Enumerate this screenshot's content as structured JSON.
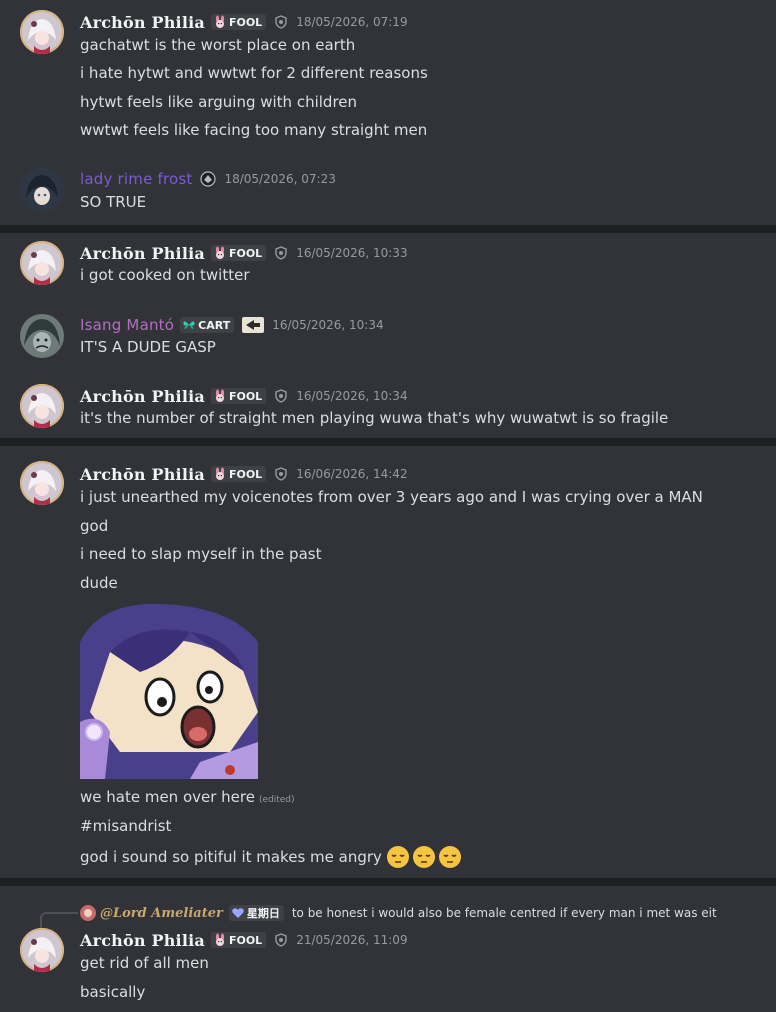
{
  "messages": {
    "m1": {
      "author": "Archōn Philia",
      "tag": "FOOL",
      "timestamp": "18/05/2026, 07:19",
      "lines": [
        "gachatwt is the worst place on earth",
        "i hate hytwt and wwtwt for 2 different reasons",
        "hytwt feels like arguing with children",
        "wwtwt feels like facing too many straight men"
      ]
    },
    "m2": {
      "author": "lady rime frost",
      "timestamp": "18/05/2026, 07:23",
      "lines": [
        "SO TRUE"
      ]
    },
    "m3": {
      "author": "Archōn Philia",
      "tag": "FOOL",
      "timestamp": "16/05/2026, 10:33",
      "lines": [
        "i got cooked on twitter"
      ]
    },
    "m4": {
      "author": "Isang Mantó",
      "tag": "CART",
      "timestamp": "16/05/2026, 10:34",
      "lines": [
        "IT'S A DUDE GASP"
      ]
    },
    "m5": {
      "author": "Archōn Philia",
      "tag": "FOOL",
      "timestamp": "16/05/2026, 10:34",
      "lines": [
        "it's the number of straight men playing wuwa that's why wuwatwt is so fragile"
      ]
    },
    "m6": {
      "author": "Archōn Philia",
      "tag": "FOOL",
      "timestamp": "16/06/2026, 14:42",
      "lines": [
        "i just unearthed my voicenotes from over 3 years ago and I was crying over a MAN",
        "god",
        "i need to slap myself in the past",
        "dude"
      ],
      "after_sticker": [
        "we hate men over here",
        "#misandrist",
        "god i sound so pitiful it makes me angry"
      ],
      "edited_label": "(edited)",
      "emoji_count": 3
    },
    "m7": {
      "reply_author": "@Lord Ameliater",
      "reply_tag": "星期日",
      "reply_text": "to be honest i would also be female centred if every man i met was eit",
      "author": "Archōn Philia",
      "tag": "FOOL",
      "timestamp": "21/05/2026, 11:09",
      "lines": [
        "get rid of all men",
        "basically"
      ]
    }
  },
  "colors": {
    "background": "#313338",
    "divider": "#1e1f22",
    "text": "#dbdee1",
    "timestamp": "#949ba4",
    "rime_name": "#7b5bd4",
    "isang_name": "#b06fc0",
    "cart_tag_icon": "#2ed3b7",
    "fool_tag_icon": "#e88aa8"
  },
  "icons": [
    "avatar",
    "bunny-tag-icon",
    "shield-icon",
    "butterfly-tag-icon",
    "arrow-badge-icon",
    "sleepy-face-emoji",
    "reply-spine",
    "sticker-image"
  ]
}
